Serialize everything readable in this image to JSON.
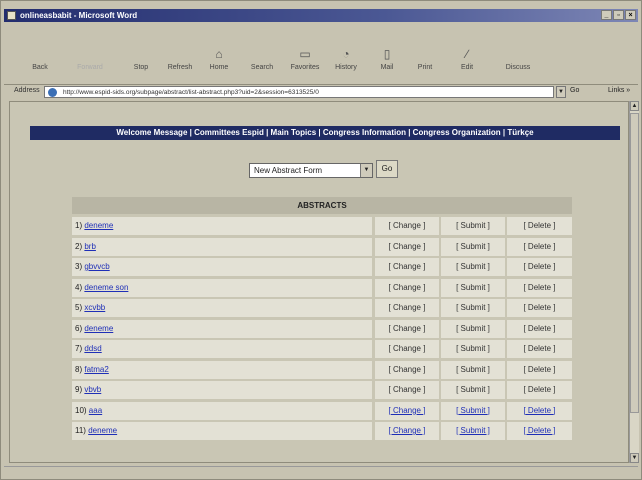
{
  "window": {
    "title": "onlineasbabit - Microsoft Word",
    "buttons": [
      "_",
      "▫",
      "×"
    ]
  },
  "toolbar": [
    {
      "icon": "back-icon",
      "label": "Back",
      "glyph": ""
    },
    {
      "icon": "forward-icon",
      "label": "Forward",
      "glyph": ""
    },
    {
      "icon": "stop-icon",
      "label": "Stop",
      "glyph": ""
    },
    {
      "icon": "refresh-icon",
      "label": "Refresh",
      "glyph": ""
    },
    {
      "icon": "home-icon",
      "label": "Home",
      "glyph": "⌂"
    },
    {
      "icon": "search-icon",
      "label": "Search",
      "glyph": ""
    },
    {
      "icon": "favorites-icon",
      "label": "Favorites",
      "glyph": "▭"
    },
    {
      "icon": "history-icon",
      "label": "History",
      "glyph": "◔"
    },
    {
      "icon": "mail-icon",
      "label": "Mail",
      "glyph": "▯"
    },
    {
      "icon": "print-icon",
      "label": "Print",
      "glyph": ""
    },
    {
      "icon": "edit-icon",
      "label": "Edit",
      "glyph": "∕"
    },
    {
      "icon": "discuss-icon",
      "label": "Discuss",
      "glyph": ""
    }
  ],
  "address": {
    "label": "Address",
    "url": "http://www.espid-sids.org/subpage/abstract/list-abstract.php3?uid=2&session=6313525/0",
    "go": "Go",
    "links": "Links »"
  },
  "nav": {
    "text": "Welcome Message | Committees Espid | Main Topics | Congress Information | Congress Organization | Türkçe"
  },
  "form": {
    "select_value": "New Abstract Form",
    "go_label": "Go"
  },
  "abstracts": {
    "header": "ABSTRACTS",
    "rows": [
      {
        "num": "1)",
        "name": "deneme",
        "change": "[ Change ]",
        "submit": "[ Submit ]",
        "delete": "[ Delete ]"
      },
      {
        "num": "2)",
        "name": "brb",
        "change": "[ Change ]",
        "submit": "[ Submit ]",
        "delete": "[ Delete ]"
      },
      {
        "num": "3)",
        "name": "gbvvcb",
        "change": "[ Change ]",
        "submit": "[ Submit ]",
        "delete": "[ Delete ]"
      },
      {
        "num": "4)",
        "name": "deneme son",
        "change": "[ Change ]",
        "submit": "[ Submit ]",
        "delete": "[ Delete ]"
      },
      {
        "num": "5)",
        "name": "xcvbb",
        "change": "[ Change ]",
        "submit": "[ Submit ]",
        "delete": "[ Delete ]"
      },
      {
        "num": "6)",
        "name": "deneme",
        "change": "[ Change ]",
        "submit": "[ Submit ]",
        "delete": "[ Delete ]"
      },
      {
        "num": "7)",
        "name": "ddsd",
        "change": "[ Change ]",
        "submit": "[ Submit ]",
        "delete": "[ Delete ]"
      },
      {
        "num": "8)",
        "name": "fatma2",
        "change": "[ Change ]",
        "submit": "[ Submit ]",
        "delete": "[ Delete ]"
      },
      {
        "num": "9)",
        "name": "vbvb",
        "change": "[ Change ]",
        "submit": "[ Submit ]",
        "delete": "[ Delete ]"
      },
      {
        "num": "10)",
        "name": "aaa",
        "change": "[ Change ]",
        "submit": "[ Submit ]",
        "delete": "[ Delete ]"
      },
      {
        "num": "11)",
        "name": "deneme",
        "change": "[ Change ]",
        "submit": "[ Submit ]",
        "delete": "[ Delete ]"
      }
    ]
  },
  "colors": {
    "nav_bg": "#1f2b63",
    "link": "#1f2fb7",
    "page_bg": "#c9c6b4",
    "cell_bg": "#e3e1d5"
  }
}
